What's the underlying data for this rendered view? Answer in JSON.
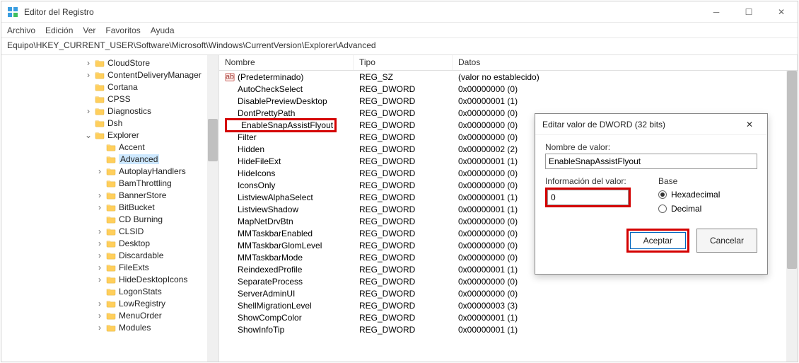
{
  "window": {
    "title": "Editor del Registro"
  },
  "menu": [
    "Archivo",
    "Edición",
    "Ver",
    "Favoritos",
    "Ayuda"
  ],
  "address": "Equipo\\HKEY_CURRENT_USER\\Software\\Microsoft\\Windows\\CurrentVersion\\Explorer\\Advanced",
  "tree": [
    {
      "d": 7,
      "e": ">",
      "t": "CloudStore"
    },
    {
      "d": 7,
      "e": ">",
      "t": "ContentDeliveryManager"
    },
    {
      "d": 7,
      "e": "",
      "t": "Cortana"
    },
    {
      "d": 7,
      "e": "",
      "t": "CPSS"
    },
    {
      "d": 7,
      "e": ">",
      "t": "Diagnostics"
    },
    {
      "d": 7,
      "e": "",
      "t": "Dsh"
    },
    {
      "d": 7,
      "e": "v",
      "t": "Explorer"
    },
    {
      "d": 8,
      "e": "",
      "t": "Accent"
    },
    {
      "d": 8,
      "e": "",
      "t": "Advanced",
      "sel": true
    },
    {
      "d": 8,
      "e": ">",
      "t": "AutoplayHandlers"
    },
    {
      "d": 8,
      "e": "",
      "t": "BamThrottling"
    },
    {
      "d": 8,
      "e": ">",
      "t": "BannerStore"
    },
    {
      "d": 8,
      "e": ">",
      "t": "BitBucket"
    },
    {
      "d": 8,
      "e": "",
      "t": "CD Burning"
    },
    {
      "d": 8,
      "e": ">",
      "t": "CLSID"
    },
    {
      "d": 8,
      "e": ">",
      "t": "Desktop"
    },
    {
      "d": 8,
      "e": ">",
      "t": "Discardable"
    },
    {
      "d": 8,
      "e": ">",
      "t": "FileExts"
    },
    {
      "d": 8,
      "e": ">",
      "t": "HideDesktopIcons"
    },
    {
      "d": 8,
      "e": "",
      "t": "LogonStats"
    },
    {
      "d": 8,
      "e": ">",
      "t": "LowRegistry"
    },
    {
      "d": 8,
      "e": ">",
      "t": "MenuOrder"
    },
    {
      "d": 8,
      "e": ">",
      "t": "Modules"
    }
  ],
  "columns": {
    "name": "Nombre",
    "type": "Tipo",
    "data": "Datos"
  },
  "values": [
    {
      "i": "sz",
      "n": "(Predeterminado)",
      "t": "REG_SZ",
      "d": "(valor no establecido)"
    },
    {
      "i": "dw",
      "n": "AutoCheckSelect",
      "t": "REG_DWORD",
      "d": "0x00000000 (0)"
    },
    {
      "i": "dw",
      "n": "DisablePreviewDesktop",
      "t": "REG_DWORD",
      "d": "0x00000001 (1)"
    },
    {
      "i": "dw",
      "n": "DontPrettyPath",
      "t": "REG_DWORD",
      "d": "0x00000000 (0)"
    },
    {
      "i": "dw",
      "n": "EnableSnapAssistFlyout",
      "t": "REG_DWORD",
      "d": "0x00000000 (0)",
      "hl": true
    },
    {
      "i": "dw",
      "n": "Filter",
      "t": "REG_DWORD",
      "d": "0x00000000 (0)"
    },
    {
      "i": "dw",
      "n": "Hidden",
      "t": "REG_DWORD",
      "d": "0x00000002 (2)"
    },
    {
      "i": "dw",
      "n": "HideFileExt",
      "t": "REG_DWORD",
      "d": "0x00000001 (1)"
    },
    {
      "i": "dw",
      "n": "HideIcons",
      "t": "REG_DWORD",
      "d": "0x00000000 (0)"
    },
    {
      "i": "dw",
      "n": "IconsOnly",
      "t": "REG_DWORD",
      "d": "0x00000000 (0)"
    },
    {
      "i": "dw",
      "n": "ListviewAlphaSelect",
      "t": "REG_DWORD",
      "d": "0x00000001 (1)"
    },
    {
      "i": "dw",
      "n": "ListviewShadow",
      "t": "REG_DWORD",
      "d": "0x00000001 (1)"
    },
    {
      "i": "dw",
      "n": "MapNetDrvBtn",
      "t": "REG_DWORD",
      "d": "0x00000000 (0)"
    },
    {
      "i": "dw",
      "n": "MMTaskbarEnabled",
      "t": "REG_DWORD",
      "d": "0x00000000 (0)"
    },
    {
      "i": "dw",
      "n": "MMTaskbarGlomLevel",
      "t": "REG_DWORD",
      "d": "0x00000000 (0)"
    },
    {
      "i": "dw",
      "n": "MMTaskbarMode",
      "t": "REG_DWORD",
      "d": "0x00000000 (0)"
    },
    {
      "i": "dw",
      "n": "ReindexedProfile",
      "t": "REG_DWORD",
      "d": "0x00000001 (1)"
    },
    {
      "i": "dw",
      "n": "SeparateProcess",
      "t": "REG_DWORD",
      "d": "0x00000000 (0)"
    },
    {
      "i": "dw",
      "n": "ServerAdminUI",
      "t": "REG_DWORD",
      "d": "0x00000000 (0)"
    },
    {
      "i": "dw",
      "n": "ShellMigrationLevel",
      "t": "REG_DWORD",
      "d": "0x00000003 (3)"
    },
    {
      "i": "dw",
      "n": "ShowCompColor",
      "t": "REG_DWORD",
      "d": "0x00000001 (1)"
    },
    {
      "i": "dw",
      "n": "ShowInfoTip",
      "t": "REG_DWORD",
      "d": "0x00000001 (1)"
    }
  ],
  "dialog": {
    "title": "Editar valor de DWORD (32 bits)",
    "name_label": "Nombre de valor:",
    "name_value": "EnableSnapAssistFlyout",
    "value_label": "Información del valor:",
    "value_value": "0",
    "base_label": "Base",
    "hex": "Hexadecimal",
    "dec": "Decimal",
    "ok": "Aceptar",
    "cancel": "Cancelar"
  }
}
